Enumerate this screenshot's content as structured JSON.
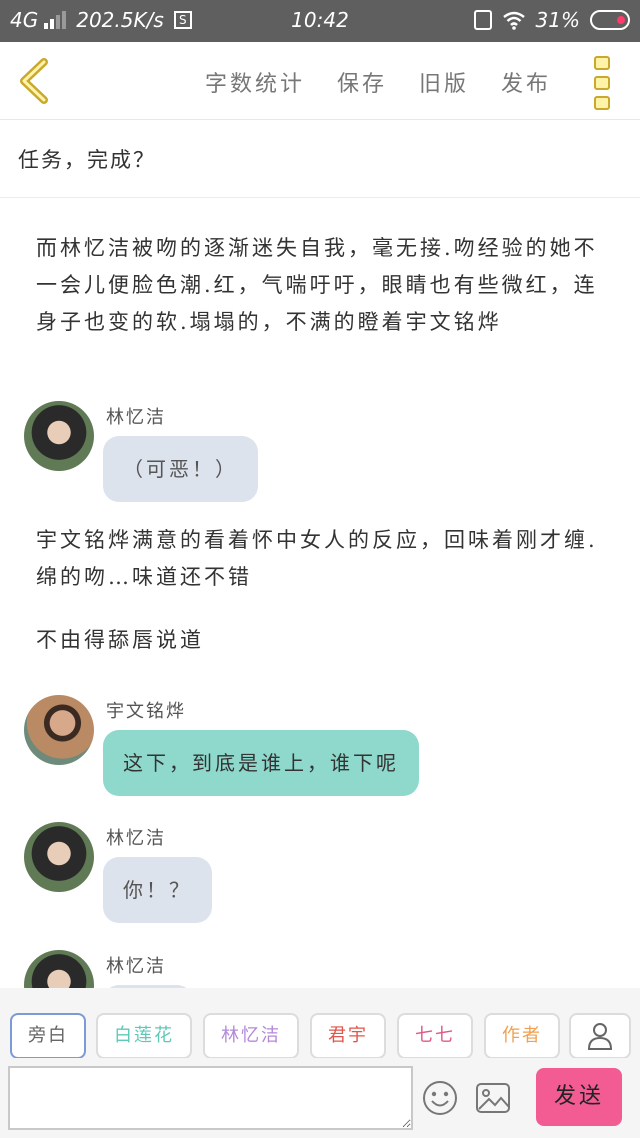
{
  "status_bar": {
    "network": "4G",
    "speed": "202.5K/s",
    "s_badge": "S",
    "time": "10:42",
    "battery": "31%"
  },
  "header": {
    "back_icon": "chevron-left-icon",
    "menu": [
      "字数统计",
      "保存",
      "旧版",
      "发布"
    ],
    "more_icon": "more-vertical-icon",
    "accent_color": "#c9a82e"
  },
  "title": "任务，完成？",
  "story": {
    "narration_1": "而林忆洁被吻的逐渐迷失自我，毫无接.吻经验的她不一会儿便脸色潮.红，气喘吁吁，眼睛也有些微红，连身子也变的软.塌塌的，不满的瞪着宇文铭烨",
    "msg_1": {
      "sender": "林忆洁",
      "text": "（可恶！）"
    },
    "narration_2": "宇文铭烨满意的看着怀中女人的反应，回味着刚才缠.绵的吻…味道还不错",
    "narration_3": "不由得舔唇说道",
    "msg_2": {
      "sender": "宇文铭烨",
      "text": "这下，到底是谁上，谁下呢"
    },
    "msg_3": {
      "sender": "林忆洁",
      "text": "你！？"
    },
    "msg_4": {
      "sender": "林忆洁"
    }
  },
  "roles": [
    {
      "label": "旁白",
      "color": "#666666"
    },
    {
      "label": "白莲花",
      "color": "#5ec9b8"
    },
    {
      "label": "林忆洁",
      "color": "#b388d9"
    },
    {
      "label": "君宇",
      "color": "#e0564a"
    },
    {
      "label": "七七",
      "color": "#e05a8a"
    },
    {
      "label": "作者",
      "color": "#f0a050"
    }
  ],
  "composer": {
    "input_value": "",
    "send_label": "发送",
    "send_color": "#f25c93"
  }
}
